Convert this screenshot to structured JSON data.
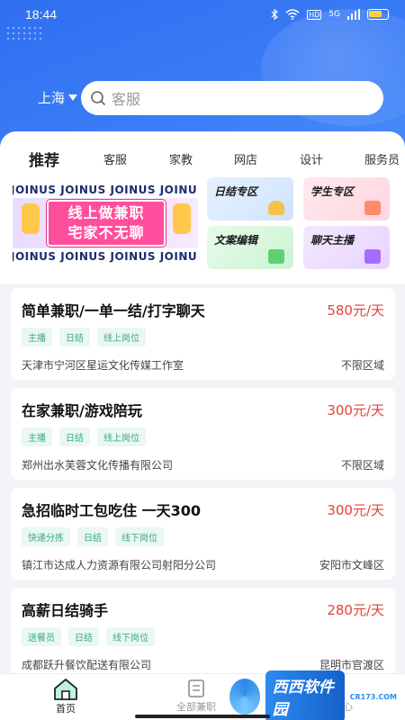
{
  "status_bar": {
    "time": "18:44",
    "signal_text": "HD",
    "net": "5G"
  },
  "header": {
    "city": "上海",
    "search_placeholder": "客服"
  },
  "tabs": [
    "推荐",
    "客服",
    "家教",
    "网店",
    "设计",
    "服务员"
  ],
  "banner": {
    "repeat_text": "JOINUS JOINUS JOINUS JOINUS",
    "line1": "线上做兼职",
    "line2": "宅家不无聊"
  },
  "categories": [
    {
      "label": "日结专区"
    },
    {
      "label": "学生专区"
    },
    {
      "label": "文案编辑"
    },
    {
      "label": "聊天主播"
    }
  ],
  "jobs": [
    {
      "title": "简单兼职/一单一结/打字聊天",
      "pay": "580元/天",
      "tags": [
        "主播",
        "日结",
        "线上岗位"
      ],
      "company": "天津市宁河区星运文化传媒工作室",
      "region": "不限区域"
    },
    {
      "title": "在家兼职/游戏陪玩",
      "pay": "300元/天",
      "tags": [
        "主播",
        "日结",
        "线上岗位"
      ],
      "company": "郑州出水芙蓉文化传播有限公司",
      "region": "不限区域"
    },
    {
      "title": "急招临时工包吃住 一天300",
      "pay": "300元/天",
      "tags": [
        "快递分拣",
        "日结",
        "线下岗位"
      ],
      "company": "镇江市达成人力资源有限公司射阳分公司",
      "region": "安阳市文峰区"
    },
    {
      "title": "高薪日结骑手",
      "pay": "280元/天",
      "tags": [
        "送餐员",
        "日结",
        "线下岗位"
      ],
      "company": "成都跃升餐饮配送有限公司",
      "region": "昆明市官渡区"
    }
  ],
  "bottom_nav": {
    "home": "首页",
    "parttime": "全部兼职",
    "profile": "个人中心"
  },
  "watermark": {
    "text": "西西软件园",
    "sub": "CR173.COM"
  },
  "colors": {
    "primary": "#3a7cf6",
    "pay": "#e2433a",
    "tag": "#3ba78d"
  }
}
